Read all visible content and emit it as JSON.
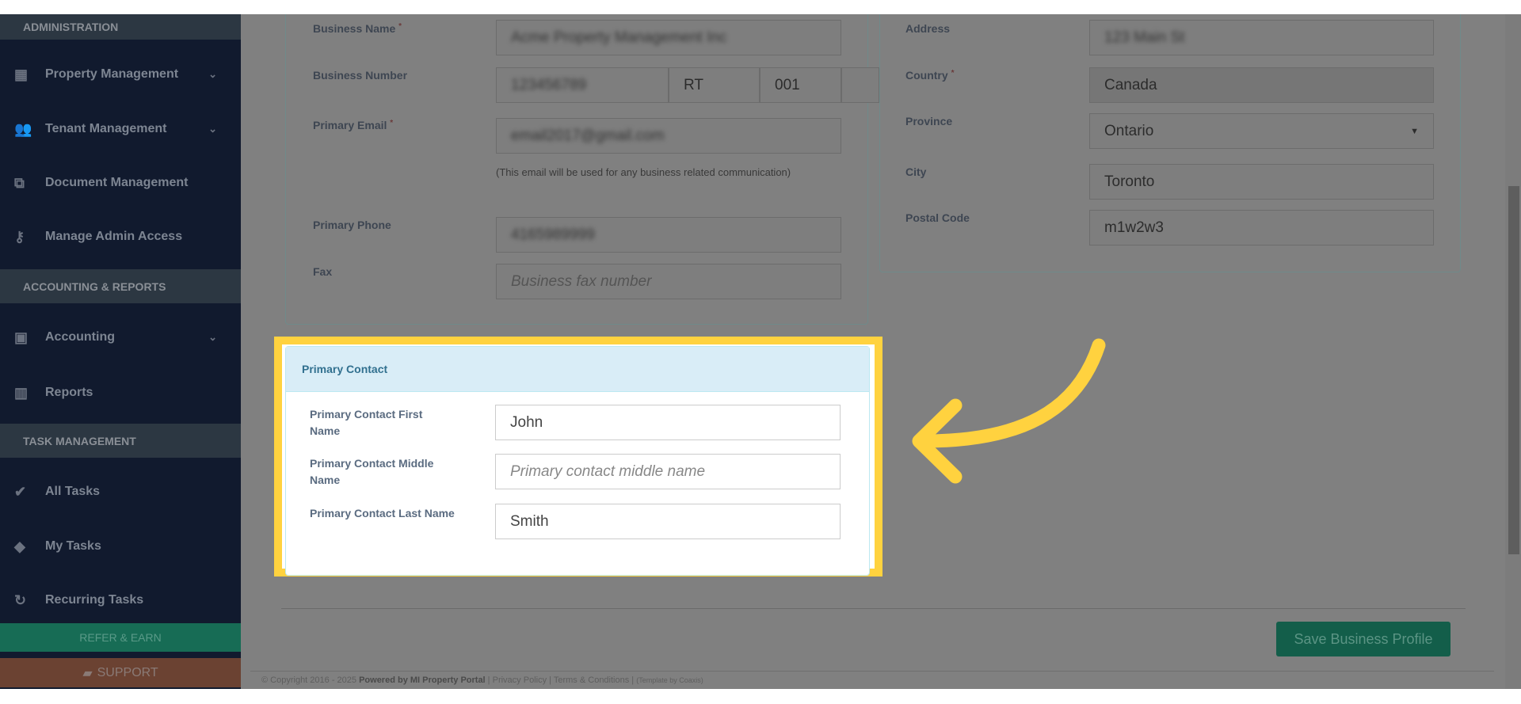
{
  "sidebar": {
    "sections": [
      "ADMINISTRATION",
      "ACCOUNTING & REPORTS",
      "TASK MANAGEMENT"
    ],
    "items": [
      {
        "label": "Property Management",
        "icon": "building-icon"
      },
      {
        "label": "Tenant Management",
        "icon": "users-icon"
      },
      {
        "label": "Document Management",
        "icon": "copy-icon"
      },
      {
        "label": "Manage Admin Access",
        "icon": "key-icon"
      },
      {
        "label": "Accounting",
        "icon": "money-icon"
      },
      {
        "label": "Reports",
        "icon": "bar-chart-icon"
      },
      {
        "label": "All Tasks",
        "icon": "check-icon"
      },
      {
        "label": "My Tasks",
        "icon": "tag-icon"
      },
      {
        "label": "Recurring Tasks",
        "icon": "refresh-icon"
      }
    ],
    "refer": "REFER & EARN",
    "support": "SUPPORT"
  },
  "business": {
    "name_label": "Business Name",
    "name_value": "Acme Property Management Inc",
    "number_label": "Business Number",
    "number_value": "123456789",
    "number_rt": "RT",
    "number_suffix": "001",
    "email_label": "Primary Email",
    "email_value": "email2017@gmail.com",
    "email_help": "(This email will be used for any business related communication)",
    "phone_label": "Primary Phone",
    "phone_value": "4165989999",
    "fax_label": "Fax",
    "fax_placeholder": "Business fax number",
    "required": "*"
  },
  "address": {
    "address_label": "Address",
    "address_value": "123 Main St",
    "country_label": "Country",
    "country_value": "Canada",
    "province_label": "Province",
    "province_value": "Ontario",
    "city_label": "City",
    "city_value": "Toronto",
    "postal_label": "Postal Code",
    "postal_value": "m1w2w3"
  },
  "primary_contact": {
    "title": "Primary Contact",
    "first_label": "Primary Contact First Name",
    "first_value": "John",
    "middle_label": "Primary Contact Middle Name",
    "middle_placeholder": "Primary contact middle name",
    "last_label": "Primary Contact Last Name",
    "last_value": "Smith"
  },
  "save_label": "Save Business Profile",
  "footer": {
    "copyright": "© Copyright 2016 - 2025",
    "powered": "Powered by MI Property Portal",
    "privacy": "Privacy Policy",
    "terms": "Terms & Conditions",
    "template": "(Template by Coaxis)"
  },
  "colors": {
    "highlight": "#ffd23f",
    "save": "#1abc9c"
  }
}
